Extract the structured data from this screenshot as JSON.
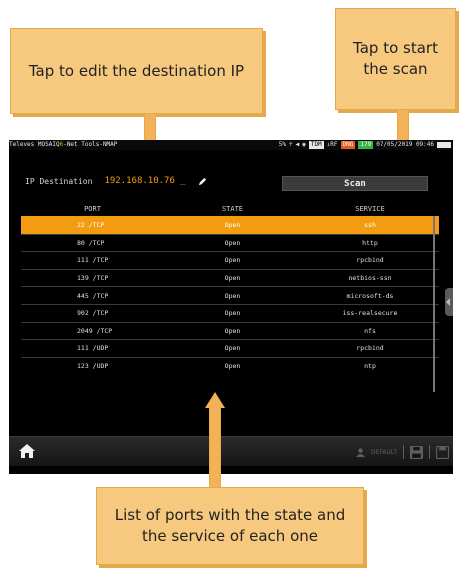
{
  "callouts": {
    "ip": "Tap to edit the destination IP",
    "scan": "Tap to start the scan",
    "list": "List of ports with the state and the service of each one"
  },
  "statusbar": {
    "brand": "Televes MOSAIQ",
    "brand_os": "6",
    "app": "-Net Tools-NMAP",
    "signal": "5%",
    "tdm": "TDM",
    "rf": "↓RF",
    "dng": "DNG",
    "level": "179",
    "datetime": "07/05/2019 09:46"
  },
  "ip_destination": {
    "label": "IP Destination",
    "value": "192.168.10.76 _"
  },
  "scan_button": {
    "label": "Scan"
  },
  "table": {
    "headers": {
      "port": "PORT",
      "state": "STATE",
      "service": "SERVICE"
    },
    "rows": [
      {
        "port": "22 /TCP",
        "state": "Open",
        "service": "ssh"
      },
      {
        "port": "80 /TCP",
        "state": "Open",
        "service": "http"
      },
      {
        "port": "111 /TCP",
        "state": "Open",
        "service": "rpcbind"
      },
      {
        "port": "139 /TCP",
        "state": "Open",
        "service": "netbios-ssn"
      },
      {
        "port": "445 /TCP",
        "state": "Open",
        "service": "microsoft-ds"
      },
      {
        "port": "902 /TCP",
        "state": "Open",
        "service": "iss-realsecure"
      },
      {
        "port": "2049 /TCP",
        "state": "Open",
        "service": "nfs"
      },
      {
        "port": "111 /UDP",
        "state": "Open",
        "service": "rpcbind"
      },
      {
        "port": "123 /UDP",
        "state": "Open",
        "service": "ntp"
      }
    ],
    "selected_index": 0
  },
  "bottom_bar": {
    "home_icon": "home-icon",
    "default_label": "DEFAULT",
    "icons": [
      "user-icon",
      "save-icon",
      "save-as-icon"
    ]
  },
  "colors": {
    "accent": "#f39c12",
    "callout": "#f7c97e",
    "background": "#000000"
  }
}
